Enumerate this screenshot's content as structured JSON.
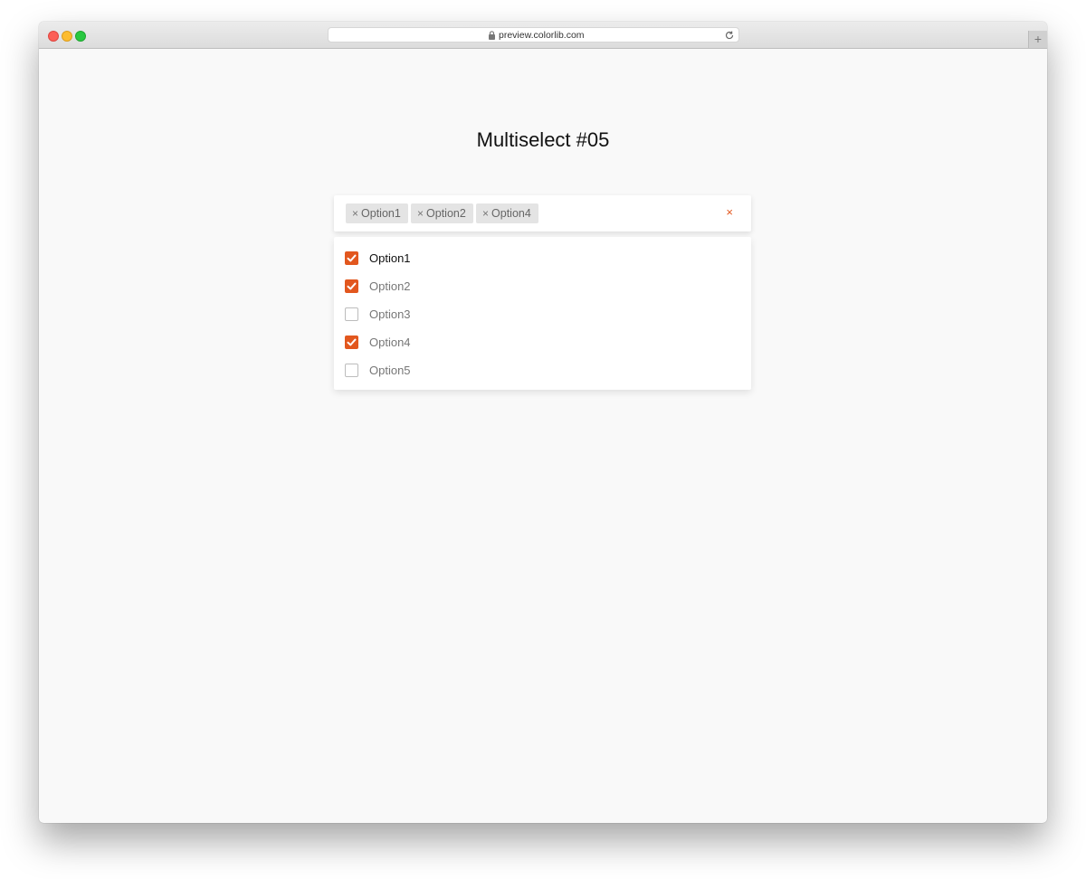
{
  "browser": {
    "url": "preview.colorlib.com",
    "new_tab_label": "+"
  },
  "page": {
    "title": "Multiselect #05"
  },
  "multiselect": {
    "selected_tags": [
      {
        "remove_symbol": "×",
        "label": "Option1"
      },
      {
        "remove_symbol": "×",
        "label": "Option2"
      },
      {
        "remove_symbol": "×",
        "label": "Option4"
      }
    ],
    "clear_all_symbol": "×",
    "options": [
      {
        "label": "Option1",
        "checked": true
      },
      {
        "label": "Option2",
        "checked": true
      },
      {
        "label": "Option3",
        "checked": false
      },
      {
        "label": "Option4",
        "checked": true
      },
      {
        "label": "Option5",
        "checked": false
      }
    ]
  },
  "colors": {
    "accent": "#e2571e",
    "page_background": "#f9f9f9",
    "tag_background": "#e4e4e4"
  }
}
